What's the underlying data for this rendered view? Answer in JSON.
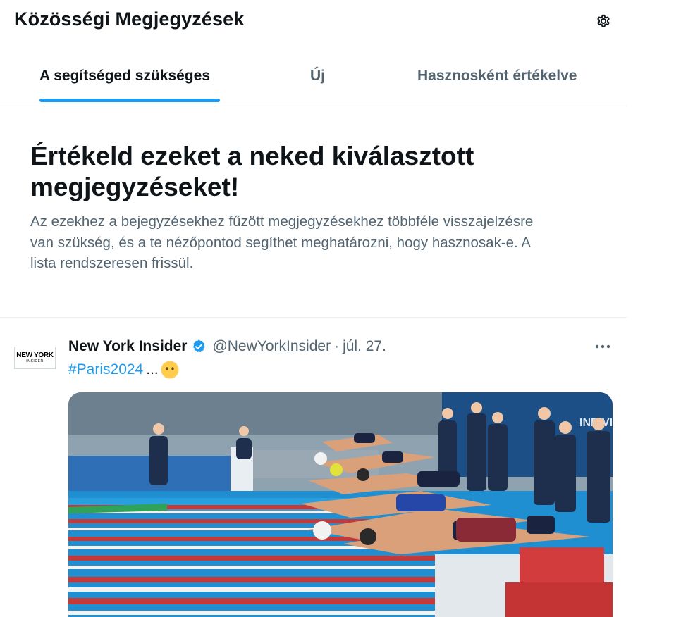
{
  "header": {
    "title": "Közösségi Megjegyzések",
    "settings_icon": "gear-icon"
  },
  "tabs": [
    {
      "label": "A segítséged szükséges",
      "active": true
    },
    {
      "label": "Új",
      "active": false
    },
    {
      "label": "Hasznosként értékelve",
      "active": false
    }
  ],
  "intro": {
    "title_line1": "Értékeld ezeket a neked kiválasztott",
    "title_line2": "megjegyzéseket!",
    "text_line1": "Az ezekhez a bejegyzésekhez fűzött megjegyzésekhez többféle visszajelzésre",
    "text_line2": "van szükség, és a te nézőpontod segíthet meghatározni, hogy hasznosak-e. A",
    "text_line3": "lista rendszeresen frissül."
  },
  "post": {
    "avatar_line1": "NEW YORK",
    "avatar_line2": "INSIDER",
    "author": "New York Insider",
    "handle": "@NewYorkInsider",
    "separator": "·",
    "date": "júl. 27.",
    "hashtag": "#Paris2024",
    "ellipsis": "...",
    "emoji_icon": "no-mouth-face-icon",
    "media_description_icon": "swimming-race-photo",
    "pool_sign": "INDIVIDU"
  },
  "colors": {
    "accent": "#1d9bf0",
    "text": "#0f1419",
    "secondary": "#536471",
    "border": "#eff3f4"
  }
}
